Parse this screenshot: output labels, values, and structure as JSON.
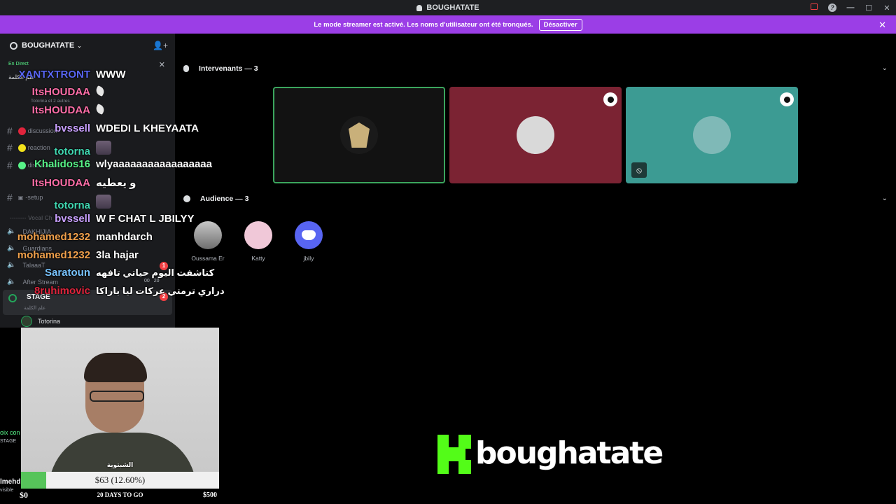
{
  "titlebar": {
    "title": "BOUGHATATE"
  },
  "banner": {
    "text": "Le mode streamer est activé. Les noms d'utilisateur ont été tronqués.",
    "button": "Désactiver",
    "color": "#9b3ee6"
  },
  "sidebar": {
    "server_name": "BOUGHATATE",
    "live_label": "En Direct",
    "stage_title_arabic": "علم الكلمة",
    "stage_sub": "Totorina et 2 autres",
    "channels": [
      "discussion",
      "reaction",
      "discussion",
      "-setup"
    ],
    "category_voice": "-------- Vocal Ch",
    "voice_channels": [
      "DAKHIJIA",
      "Guardians",
      "TalaaaT",
      "After Stream"
    ],
    "stage_channel": {
      "label": "STAGE",
      "sub": "علم الكلمة",
      "badge": "2"
    },
    "after_stream_counts": [
      "00",
      "20"
    ],
    "badge_one": "1",
    "stage_user": "Totorina",
    "cut_labels": [
      "oix con",
      "STAGE",
      "lmehd",
      "visible"
    ]
  },
  "chat": [
    {
      "user": "XANTXTRONT",
      "msg": "WWW",
      "color": "#5865f2"
    },
    {
      "user": "ItsHOUDAA",
      "msg": "",
      "color": "#ff6ea8",
      "emote": "feather"
    },
    {
      "user": "ItsHOUDAA",
      "msg": "",
      "color": "#ff6ea8",
      "emote": "feather"
    },
    {
      "user": "bvssell",
      "msg": "WDEDI L KHEYAATA",
      "color": "#c9a0ff"
    },
    {
      "user": "totorna",
      "msg": "",
      "color": "#3fd6b0",
      "emote": "face"
    },
    {
      "user": "Khalidos16",
      "msg": "wlyaaaaaaaaaaaaaaaaa",
      "color": "#57f287"
    },
    {
      "user": "ItsHOUDAA",
      "msg": "و يعطيه",
      "color": "#ff6ea8"
    },
    {
      "user": "totorna",
      "msg": "",
      "color": "#3fd6b0",
      "emote": "face"
    },
    {
      "user": "bvssell",
      "msg": "W F CHAT L JBILYY",
      "color": "#c9a0ff"
    },
    {
      "user": "mohamed1232",
      "msg": "manhdarch",
      "color": "#f0a04b"
    },
    {
      "user": "mohamed1232",
      "msg": "3la hajar",
      "color": "#f0a04b"
    },
    {
      "user": "Saratoun",
      "msg": "كتاشفت اليوم حياتي تافهه",
      "color": "#79c4ff"
    },
    {
      "user": "8ruhimovic",
      "msg": "دراري ترمتي عركات ليا باراكا",
      "color": "#e0243c"
    }
  ],
  "stage": {
    "speakers_label": "Intervenants — 3",
    "audience_label": "Audience — 3",
    "speaker_tiles": [
      {
        "bg": "#121212",
        "border": "#3ba55d",
        "mod": false,
        "mic_off": false
      },
      {
        "bg": "#7b2333",
        "border": "#7b2333",
        "mod": true,
        "mic_off": false
      },
      {
        "bg": "#3c9b93",
        "border": "#3c9b93",
        "mod": true,
        "mic_off": true
      }
    ],
    "audience": [
      {
        "name": "Oussama Er",
        "bg": "#b7b7b7"
      },
      {
        "name": "Katty",
        "bg": "#f0c8d8"
      },
      {
        "name": "jbiIy",
        "bg": "#5865f2"
      }
    ]
  },
  "webcam": {
    "caption": "الشبتوية"
  },
  "goal": {
    "label": "$63 (12.60%)",
    "progress": 0.126,
    "min": "$0",
    "max": "$500",
    "countdown": "20 DAYS TO GO"
  },
  "kick": {
    "name": "boughatate",
    "color": "#53fc18"
  }
}
